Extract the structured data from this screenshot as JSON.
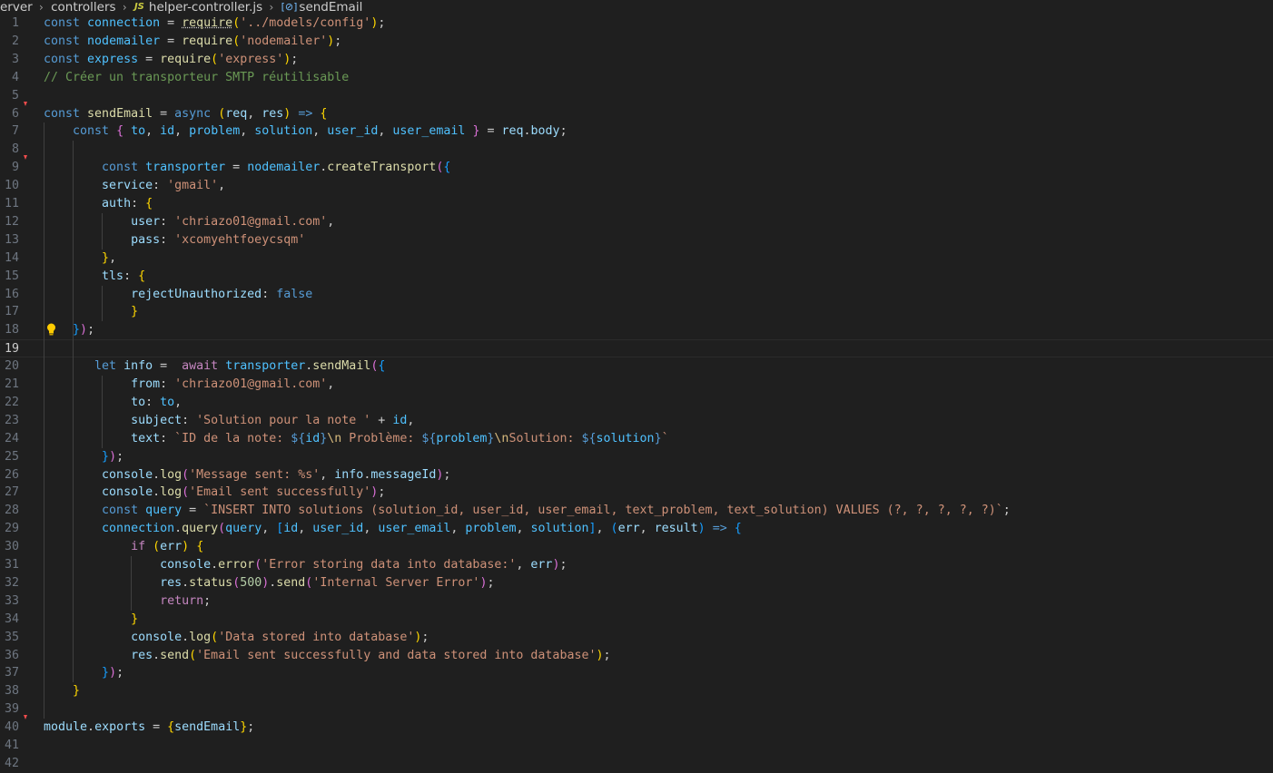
{
  "breadcrumb": {
    "segments": [
      "erver",
      "controllers",
      "helper-controller.js",
      "sendEmail"
    ],
    "file_icon": "JS",
    "symbol_icon": "[⊘]"
  },
  "colors": {
    "background": "#1f1f1f",
    "keyword": "#569cd6",
    "control": "#c586c0",
    "variable": "#9cdcfe",
    "constant": "#4fc1ff",
    "function": "#dcdcaa",
    "string": "#ce9178",
    "comment": "#6a9955",
    "number": "#b5cea8",
    "bracket_1": "#ffd700",
    "bracket_2": "#da70d6",
    "bracket_3": "#179fff"
  },
  "editor": {
    "current_line": 19,
    "lightbulb_line": 18,
    "change_markers": [
      6,
      9,
      40
    ],
    "lines": [
      [
        [
          "const",
          "k"
        ],
        [
          " ",
          "p"
        ],
        [
          "connection",
          "cn"
        ],
        [
          " = ",
          "p"
        ],
        [
          "require",
          "f sq"
        ],
        [
          "(",
          "b1"
        ],
        [
          "'../models/config'",
          "s"
        ],
        [
          ")",
          "b1"
        ],
        [
          ";",
          "p"
        ]
      ],
      [
        [
          "const",
          "k"
        ],
        [
          " ",
          "p"
        ],
        [
          "nodemailer",
          "cn"
        ],
        [
          " = ",
          "p"
        ],
        [
          "require",
          "f"
        ],
        [
          "(",
          "b1"
        ],
        [
          "'nodemailer'",
          "s"
        ],
        [
          ")",
          "b1"
        ],
        [
          ";",
          "p"
        ]
      ],
      [
        [
          "const",
          "k"
        ],
        [
          " ",
          "p"
        ],
        [
          "express",
          "cn"
        ],
        [
          " = ",
          "p"
        ],
        [
          "require",
          "f"
        ],
        [
          "(",
          "b1"
        ],
        [
          "'express'",
          "s"
        ],
        [
          ")",
          "b1"
        ],
        [
          ";",
          "p"
        ]
      ],
      [
        [
          "// Créer un transporteur SMTP réutilisable",
          "cm"
        ]
      ],
      [],
      [
        [
          "const",
          "k"
        ],
        [
          " ",
          "p"
        ],
        [
          "sendEmail",
          "f"
        ],
        [
          " = ",
          "p"
        ],
        [
          "async",
          "k"
        ],
        [
          " ",
          "p"
        ],
        [
          "(",
          "b1"
        ],
        [
          "req",
          "v"
        ],
        [
          ", ",
          "p"
        ],
        [
          "res",
          "v"
        ],
        [
          ")",
          "b1"
        ],
        [
          " ",
          "p"
        ],
        [
          "=>",
          "k"
        ],
        [
          " ",
          "p"
        ],
        [
          "{",
          "b1"
        ]
      ],
      [
        [
          "    ",
          "p"
        ],
        [
          "const",
          "k"
        ],
        [
          " ",
          "p"
        ],
        [
          "{",
          "b2"
        ],
        [
          " ",
          "p"
        ],
        [
          "to",
          "cn"
        ],
        [
          ", ",
          "p"
        ],
        [
          "id",
          "cn"
        ],
        [
          ", ",
          "p"
        ],
        [
          "problem",
          "cn"
        ],
        [
          ", ",
          "p"
        ],
        [
          "solution",
          "cn"
        ],
        [
          ", ",
          "p"
        ],
        [
          "user_id",
          "cn"
        ],
        [
          ", ",
          "p"
        ],
        [
          "user_email",
          "cn"
        ],
        [
          " ",
          "p"
        ],
        [
          "}",
          "b2"
        ],
        [
          " = ",
          "p"
        ],
        [
          "req",
          "v"
        ],
        [
          ".",
          "p"
        ],
        [
          "body",
          "v"
        ],
        [
          ";",
          "p"
        ]
      ],
      [],
      [
        [
          "        ",
          "p"
        ],
        [
          "const",
          "k"
        ],
        [
          " ",
          "p"
        ],
        [
          "transporter",
          "cn"
        ],
        [
          " = ",
          "p"
        ],
        [
          "nodemailer",
          "cn"
        ],
        [
          ".",
          "p"
        ],
        [
          "createTransport",
          "f"
        ],
        [
          "(",
          "b2"
        ],
        [
          "{",
          "b3"
        ]
      ],
      [
        [
          "        ",
          "p"
        ],
        [
          "service",
          "v"
        ],
        [
          ": ",
          "p"
        ],
        [
          "'gmail'",
          "s"
        ],
        [
          ",",
          "p"
        ]
      ],
      [
        [
          "        ",
          "p"
        ],
        [
          "auth",
          "v"
        ],
        [
          ": ",
          "p"
        ],
        [
          "{",
          "b1"
        ]
      ],
      [
        [
          "            ",
          "p"
        ],
        [
          "user",
          "v"
        ],
        [
          ": ",
          "p"
        ],
        [
          "'chriazo01@gmail.com'",
          "s"
        ],
        [
          ",",
          "p"
        ]
      ],
      [
        [
          "            ",
          "p"
        ],
        [
          "pass",
          "v"
        ],
        [
          ": ",
          "p"
        ],
        [
          "'xcomyehtfoeycsqm'",
          "s"
        ]
      ],
      [
        [
          "        ",
          "p"
        ],
        [
          "}",
          "b1"
        ],
        [
          ",",
          "p"
        ]
      ],
      [
        [
          "        ",
          "p"
        ],
        [
          "tls",
          "v"
        ],
        [
          ": ",
          "p"
        ],
        [
          "{",
          "b1"
        ]
      ],
      [
        [
          "            ",
          "p"
        ],
        [
          "rejectUnauthorized",
          "v"
        ],
        [
          ": ",
          "p"
        ],
        [
          "false",
          "k"
        ]
      ],
      [
        [
          "            ",
          "p"
        ],
        [
          "}",
          "b1"
        ]
      ],
      [
        [
          "    ",
          "p"
        ],
        [
          "}",
          "b3"
        ],
        [
          ")",
          "b2"
        ],
        [
          ";",
          "p"
        ]
      ],
      [],
      [
        [
          "       ",
          "p"
        ],
        [
          "let",
          "k"
        ],
        [
          " ",
          "p"
        ],
        [
          "info",
          "v"
        ],
        [
          " =  ",
          "p"
        ],
        [
          "await",
          "c"
        ],
        [
          " ",
          "p"
        ],
        [
          "transporter",
          "cn"
        ],
        [
          ".",
          "p"
        ],
        [
          "sendMail",
          "f"
        ],
        [
          "(",
          "b2"
        ],
        [
          "{",
          "b3"
        ]
      ],
      [
        [
          "            ",
          "p"
        ],
        [
          "from",
          "v"
        ],
        [
          ": ",
          "p"
        ],
        [
          "'chriazo01@gmail.com'",
          "s"
        ],
        [
          ",",
          "p"
        ]
      ],
      [
        [
          "            ",
          "p"
        ],
        [
          "to",
          "v"
        ],
        [
          ": ",
          "p"
        ],
        [
          "to",
          "cn"
        ],
        [
          ",",
          "p"
        ]
      ],
      [
        [
          "            ",
          "p"
        ],
        [
          "subject",
          "v"
        ],
        [
          ": ",
          "p"
        ],
        [
          "'Solution pour la note '",
          "s"
        ],
        [
          " + ",
          "p"
        ],
        [
          "id",
          "cn"
        ],
        [
          ",",
          "p"
        ]
      ],
      [
        [
          "            ",
          "p"
        ],
        [
          "text",
          "v"
        ],
        [
          ": ",
          "p"
        ],
        [
          "`ID de la note: ",
          "s"
        ],
        [
          "${",
          "k"
        ],
        [
          "id",
          "cn"
        ],
        [
          "}",
          "k"
        ],
        [
          "\\n",
          "e"
        ],
        [
          " Problème: ",
          "s"
        ],
        [
          "${",
          "k"
        ],
        [
          "problem",
          "cn"
        ],
        [
          "}",
          "k"
        ],
        [
          "\\n",
          "e"
        ],
        [
          "Solution: ",
          "s"
        ],
        [
          "${",
          "k"
        ],
        [
          "solution",
          "cn"
        ],
        [
          "}",
          "k"
        ],
        [
          "`",
          "s"
        ]
      ],
      [
        [
          "        ",
          "p"
        ],
        [
          "}",
          "b3"
        ],
        [
          ")",
          "b2"
        ],
        [
          ";",
          "p"
        ]
      ],
      [
        [
          "        ",
          "p"
        ],
        [
          "console",
          "v"
        ],
        [
          ".",
          "p"
        ],
        [
          "log",
          "f"
        ],
        [
          "(",
          "b2"
        ],
        [
          "'Message sent: %s'",
          "s"
        ],
        [
          ", ",
          "p"
        ],
        [
          "info",
          "v"
        ],
        [
          ".",
          "p"
        ],
        [
          "messageId",
          "v"
        ],
        [
          ")",
          "b2"
        ],
        [
          ";",
          "p"
        ]
      ],
      [
        [
          "        ",
          "p"
        ],
        [
          "console",
          "v"
        ],
        [
          ".",
          "p"
        ],
        [
          "log",
          "f"
        ],
        [
          "(",
          "b2"
        ],
        [
          "'Email sent successfully'",
          "s"
        ],
        [
          ")",
          "b2"
        ],
        [
          ";",
          "p"
        ]
      ],
      [
        [
          "        ",
          "p"
        ],
        [
          "const",
          "k"
        ],
        [
          " ",
          "p"
        ],
        [
          "query",
          "cn"
        ],
        [
          " = ",
          "p"
        ],
        [
          "`INSERT INTO solutions (solution_id, user_id, user_email, text_problem, text_solution) VALUES (?, ?, ?, ?, ?)`",
          "s"
        ],
        [
          ";",
          "p"
        ]
      ],
      [
        [
          "        ",
          "p"
        ],
        [
          "connection",
          "cn"
        ],
        [
          ".",
          "p"
        ],
        [
          "query",
          "f"
        ],
        [
          "(",
          "b2"
        ],
        [
          "query",
          "cn"
        ],
        [
          ", ",
          "p"
        ],
        [
          "[",
          "b3"
        ],
        [
          "id",
          "cn"
        ],
        [
          ", ",
          "p"
        ],
        [
          "user_id",
          "cn"
        ],
        [
          ", ",
          "p"
        ],
        [
          "user_email",
          "cn"
        ],
        [
          ", ",
          "p"
        ],
        [
          "problem",
          "cn"
        ],
        [
          ", ",
          "p"
        ],
        [
          "solution",
          "cn"
        ],
        [
          "]",
          "b3"
        ],
        [
          ", ",
          "p"
        ],
        [
          "(",
          "b3"
        ],
        [
          "err",
          "v"
        ],
        [
          ", ",
          "p"
        ],
        [
          "result",
          "v"
        ],
        [
          ")",
          "b3"
        ],
        [
          " ",
          "p"
        ],
        [
          "=>",
          "k"
        ],
        [
          " ",
          "p"
        ],
        [
          "{",
          "b3"
        ]
      ],
      [
        [
          "            ",
          "p"
        ],
        [
          "if",
          "c"
        ],
        [
          " ",
          "p"
        ],
        [
          "(",
          "b1"
        ],
        [
          "err",
          "v"
        ],
        [
          ")",
          "b1"
        ],
        [
          " ",
          "p"
        ],
        [
          "{",
          "b1"
        ]
      ],
      [
        [
          "                ",
          "p"
        ],
        [
          "console",
          "v"
        ],
        [
          ".",
          "p"
        ],
        [
          "error",
          "f"
        ],
        [
          "(",
          "b2"
        ],
        [
          "'Error storing data into database:'",
          "s"
        ],
        [
          ", ",
          "p"
        ],
        [
          "err",
          "v"
        ],
        [
          ")",
          "b2"
        ],
        [
          ";",
          "p"
        ]
      ],
      [
        [
          "                ",
          "p"
        ],
        [
          "res",
          "v"
        ],
        [
          ".",
          "p"
        ],
        [
          "status",
          "f"
        ],
        [
          "(",
          "b2"
        ],
        [
          "500",
          "n"
        ],
        [
          ")",
          "b2"
        ],
        [
          ".",
          "p"
        ],
        [
          "send",
          "f"
        ],
        [
          "(",
          "b2"
        ],
        [
          "'Internal Server Error'",
          "s"
        ],
        [
          ")",
          "b2"
        ],
        [
          ";",
          "p"
        ]
      ],
      [
        [
          "                ",
          "p"
        ],
        [
          "return",
          "c"
        ],
        [
          ";",
          "p"
        ]
      ],
      [
        [
          "            ",
          "p"
        ],
        [
          "}",
          "b1"
        ]
      ],
      [
        [
          "            ",
          "p"
        ],
        [
          "console",
          "v"
        ],
        [
          ".",
          "p"
        ],
        [
          "log",
          "f"
        ],
        [
          "(",
          "b1"
        ],
        [
          "'Data stored into database'",
          "s"
        ],
        [
          ")",
          "b1"
        ],
        [
          ";",
          "p"
        ]
      ],
      [
        [
          "            ",
          "p"
        ],
        [
          "res",
          "v"
        ],
        [
          ".",
          "p"
        ],
        [
          "send",
          "f"
        ],
        [
          "(",
          "b1"
        ],
        [
          "'Email sent successfully and data stored into database'",
          "s"
        ],
        [
          ")",
          "b1"
        ],
        [
          ";",
          "p"
        ]
      ],
      [
        [
          "        ",
          "p"
        ],
        [
          "}",
          "b3"
        ],
        [
          ")",
          "b2"
        ],
        [
          ";",
          "p"
        ]
      ],
      [
        [
          "    ",
          "p"
        ],
        [
          "}",
          "b1"
        ]
      ],
      [],
      [
        [
          "module",
          "v"
        ],
        [
          ".",
          "p"
        ],
        [
          "exports",
          "v"
        ],
        [
          " = ",
          "p"
        ],
        [
          "{",
          "b1"
        ],
        [
          "sendEmail",
          "v"
        ],
        [
          "}",
          "b1"
        ],
        [
          ";",
          "p"
        ]
      ],
      [],
      []
    ]
  }
}
